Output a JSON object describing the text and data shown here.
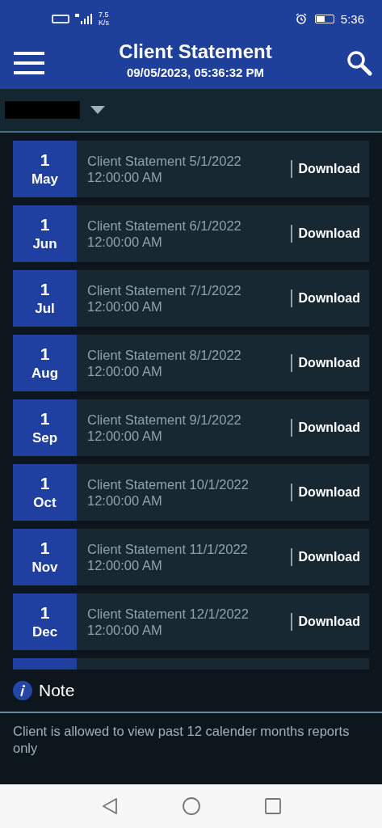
{
  "status_bar": {
    "speed_value": "7.5",
    "speed_unit": "K/s",
    "time": "5:36"
  },
  "header": {
    "title": "Client Statement",
    "subtitle": "09/05/2023, 05:36:32 PM"
  },
  "statements": [
    {
      "day": "1",
      "month": "May",
      "title": "Client Statement 5/1/2022",
      "time": "12:00:00 AM",
      "action": "Download"
    },
    {
      "day": "1",
      "month": "Jun",
      "title": "Client Statement 6/1/2022",
      "time": "12:00:00 AM",
      "action": "Download"
    },
    {
      "day": "1",
      "month": "Jul",
      "title": "Client Statement 7/1/2022",
      "time": "12:00:00 AM",
      "action": "Download"
    },
    {
      "day": "1",
      "month": "Aug",
      "title": "Client Statement 8/1/2022",
      "time": "12:00:00 AM",
      "action": "Download"
    },
    {
      "day": "1",
      "month": "Sep",
      "title": "Client Statement 9/1/2022",
      "time": "12:00:00 AM",
      "action": "Download"
    },
    {
      "day": "1",
      "month": "Oct",
      "title": "Client Statement 10/1/2022",
      "time": "12:00:00 AM",
      "action": "Download"
    },
    {
      "day": "1",
      "month": "Nov",
      "title": "Client Statement 11/1/2022",
      "time": "12:00:00 AM",
      "action": "Download"
    },
    {
      "day": "1",
      "month": "Dec",
      "title": "Client Statement 12/1/2022",
      "time": "12:00:00 AM",
      "action": "Download"
    }
  ],
  "note": {
    "title": "Note",
    "text": "Client is allowed to view past 12 calender months reports only"
  }
}
